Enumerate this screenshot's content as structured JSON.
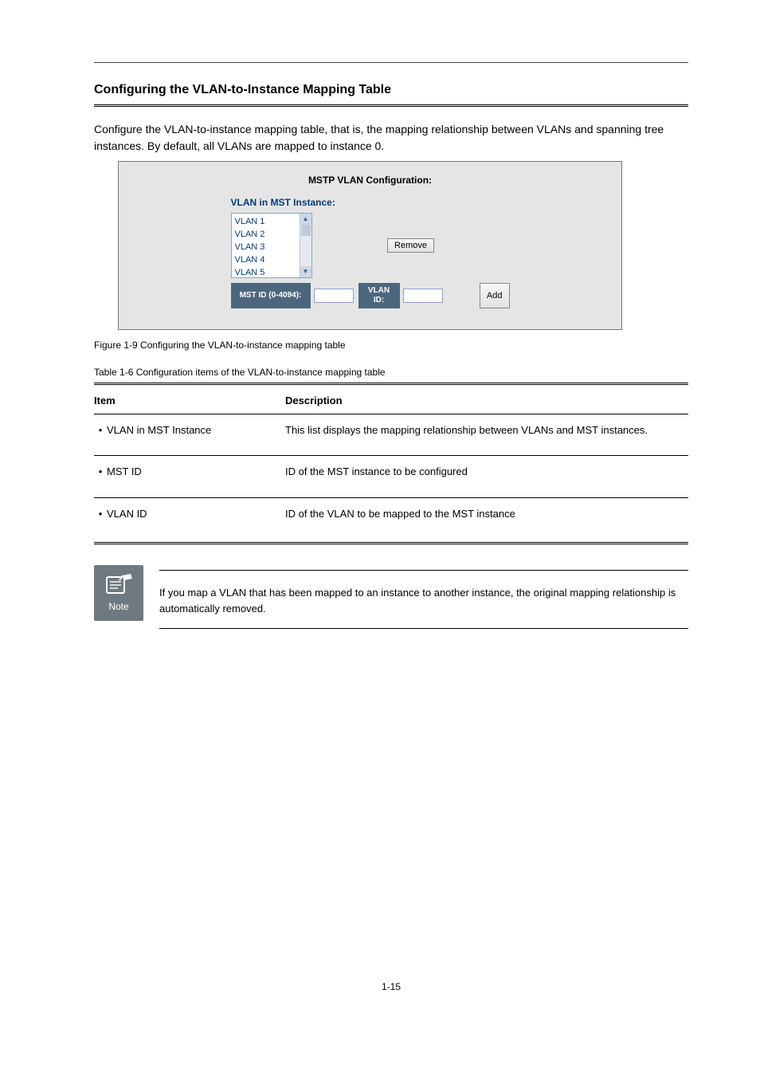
{
  "section": {
    "heading": "Configuring the VLAN-to-Instance Mapping Table",
    "intro": "Configure the VLAN-to-instance mapping table, that is, the mapping relationship between VLANs and spanning tree instances. By default, all VLANs are mapped to instance 0."
  },
  "figure": {
    "caption": "Figure 1-9 Configuring the VLAN-to-instance mapping table",
    "panel_title": "MSTP VLAN Configuration:",
    "list_label": "VLAN in MST Instance:",
    "vlan_list": [
      "VLAN 1",
      "VLAN 2",
      "VLAN 3",
      "VLAN 4",
      "VLAN 5"
    ],
    "remove_label": "Remove",
    "mst_id_label": "MST ID (0-4094):",
    "vlan_id_label": "VLAN ID:",
    "add_label": "Add"
  },
  "table": {
    "caption": "Table 1-6 Configuration items of the VLAN-to-instance mapping table",
    "header_item": "Item",
    "header_desc": "Description",
    "rows": [
      {
        "item": "VLAN in MST Instance",
        "desc": "This list displays the mapping relationship between VLANs and MST instances."
      },
      {
        "item": "MST ID",
        "desc": "ID of the MST instance to be configured"
      },
      {
        "item": "VLAN ID",
        "desc": "ID of the VLAN to be mapped to the MST instance"
      }
    ]
  },
  "note": {
    "label": "Note",
    "text": "If you map a VLAN that has been mapped to an instance to another instance, the original mapping relationship is automatically removed."
  },
  "page_number": "1-15"
}
